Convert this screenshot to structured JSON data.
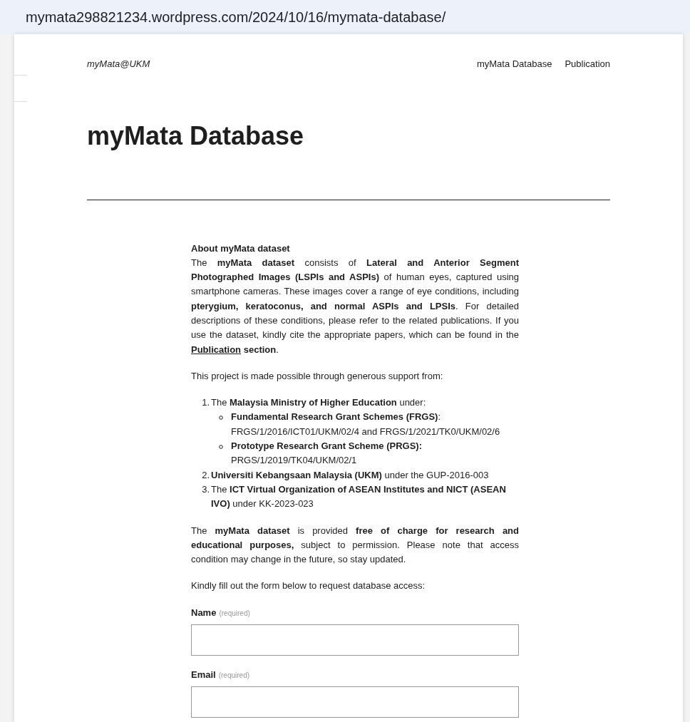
{
  "address_bar": {
    "url": "mymata298821234.wordpress.com/2024/10/16/mymata-database/"
  },
  "site": {
    "title": "myMata@UKM",
    "nav": [
      {
        "label": "myMata Database"
      },
      {
        "label": "Publication"
      }
    ]
  },
  "page_title": "myMata Database",
  "about": {
    "heading": "About myMata dataset",
    "segments": [
      {
        "kind": "text",
        "text": "The **myMata dataset** consists of **Lateral and Anterior Segment Photographed Images (LSPIs and ASPIs)** of human eyes, captured using smartphone cameras. These images cover a range of eye conditions, including **pterygium, keratoconus, and normal ASPIs and LPSIs**. For detailed descriptions of these conditions, please refer to the related publications. If you use the dataset, kindly cite the appropriate papers, which can be found in the "
      },
      {
        "kind": "link",
        "text": "Publication"
      },
      {
        "kind": "text",
        "text": " **section**."
      }
    ]
  },
  "support_intro": "This project is made possible through generous support from:",
  "support_list": [
    {
      "marker": "1.",
      "text": "The **Malaysia Ministry of Higher Education** under:",
      "children": [
        {
          "text": "**Fundamental Research Grant Schemes (FRGS)**:",
          "detail": "FRGS/1/2016/ICT01/UKM/02/4 and FRGS/1/2021/TK0/UKM/02/6"
        },
        {
          "text": "**Prototype Research Grant Scheme (PRGS):**",
          "detail": "PRGS/1/2019/TK04/UKM/02/1"
        }
      ]
    },
    {
      "marker": "2.",
      "text": "**Universiti Kebangsaan Malaysia (UKM)** under the GUP-2016-003"
    },
    {
      "marker": "3.",
      "text": "The **ICT Virtual Organization of ASEAN Institutes and NICT (ASEAN IVO)** under KK-2023-023"
    }
  ],
  "terms": "The **myMata dataset** is provided **free of charge for research and educational purposes,** subject to permission. Please note that access condition may change in the future, so stay updated.",
  "form_intro": "Kindly fill out the form below to request database access:",
  "form_fields": [
    {
      "label": "Name",
      "note": "(required)"
    },
    {
      "label": "Email",
      "note": "(required)"
    }
  ]
}
